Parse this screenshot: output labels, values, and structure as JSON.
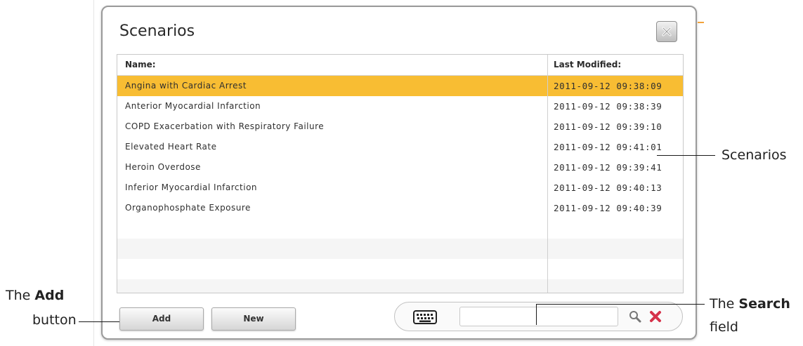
{
  "dialog": {
    "title": "Scenarios",
    "close_icon": "close-x-icon"
  },
  "table": {
    "columns": [
      "Name:",
      "Last Modified:"
    ],
    "rows": [
      {
        "name": "Angina with Cardiac Arrest",
        "modified": "2011-09-12 09:38:09",
        "selected": true
      },
      {
        "name": "Anterior Myocardial Infarction",
        "modified": "2011-09-12 09:38:39"
      },
      {
        "name": "COPD Exacerbation with Respiratory Failure",
        "modified": "2011-09-12 09:39:10"
      },
      {
        "name": "Elevated Heart Rate",
        "modified": "2011-09-12 09:41:01"
      },
      {
        "name": "Heroin Overdose",
        "modified": "2011-09-12 09:39:41"
      },
      {
        "name": "Inferior Myocardial Infarction",
        "modified": "2011-09-12 09:40:13"
      },
      {
        "name": "Organophosphate Exposure",
        "modified": "2011-09-12 09:40:39"
      }
    ],
    "selected_color": "#f8bd33"
  },
  "footer": {
    "add_label": "Add",
    "new_label": "New",
    "search": {
      "value": "",
      "keyboard_icon": "keyboard-icon",
      "search_icon": "magnifier-icon",
      "clear_icon": "red-x-icon"
    }
  },
  "annotations": {
    "add_prefix": "The ",
    "add_bold": "Add",
    "add_suffix": "button",
    "scenarios": "Scenarios",
    "search_prefix": "The ",
    "search_bold": "Search",
    "search_suffix": "field"
  }
}
